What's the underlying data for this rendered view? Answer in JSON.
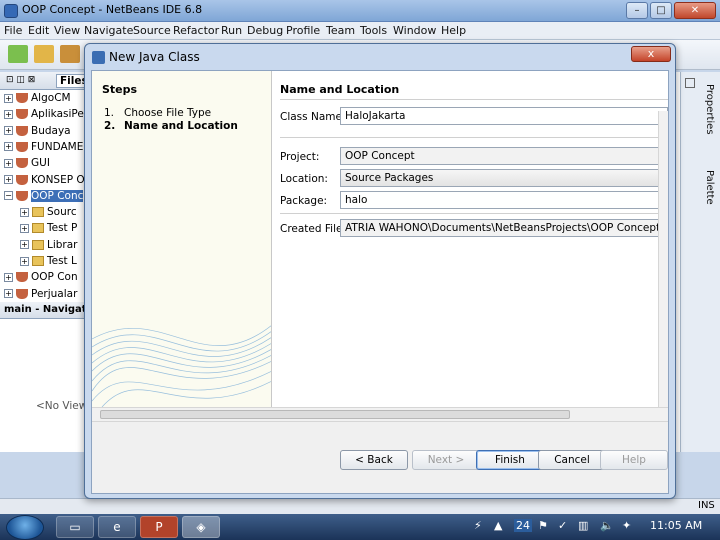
{
  "ide": {
    "title": "OOP Concept - NetBeans IDE 6.8",
    "menu": [
      "File",
      "Edit",
      "View",
      "Navigate",
      "Source",
      "Refactor",
      "Run",
      "Debug",
      "Profile",
      "Team",
      "Tools",
      "Window",
      "Help"
    ],
    "tabs": {
      "files": "Files"
    },
    "tree": [
      {
        "label": "AlgoCM",
        "type": "project",
        "expanded": false
      },
      {
        "label": "AplikasiPe",
        "type": "project",
        "expanded": false
      },
      {
        "label": "Budaya",
        "type": "project",
        "expanded": false
      },
      {
        "label": "FUNDAME",
        "type": "project",
        "expanded": false
      },
      {
        "label": "GUI",
        "type": "project",
        "expanded": false
      },
      {
        "label": "KONSEP O",
        "type": "project",
        "expanded": false
      },
      {
        "label": "OOP Conc",
        "type": "project",
        "expanded": true,
        "selected": true
      },
      {
        "label": "Sourc",
        "type": "folder",
        "indent": 1
      },
      {
        "label": "Test P",
        "type": "folder",
        "indent": 1
      },
      {
        "label": "Librar",
        "type": "folder",
        "indent": 1
      },
      {
        "label": "Test L",
        "type": "folder",
        "indent": 1
      },
      {
        "label": "OOP Con",
        "type": "project",
        "expanded": false
      },
      {
        "label": "Perjualar",
        "type": "project",
        "expanded": false
      }
    ],
    "navigator_title": "main - Navigato",
    "navigator_empty": "<No View A",
    "right_tabs": [
      "Properties",
      "Palette"
    ],
    "status": "INS"
  },
  "dialog": {
    "title": "New Java Class",
    "close_label": "x",
    "steps_title": "Steps",
    "steps": [
      {
        "num": "1.",
        "label": "Choose File Type",
        "active": false
      },
      {
        "num": "2.",
        "label": "Name and Location",
        "active": true
      }
    ],
    "section_title": "Name and Location",
    "fields": {
      "class_name_label": "Class Name:",
      "class_name_value": "HaloJakarta",
      "project_label": "Project:",
      "project_value": "OOP Concept",
      "location_label": "Location:",
      "location_value": "Source Packages",
      "package_label": "Package:",
      "package_value": "halo",
      "created_file_label": "Created File:",
      "created_file_value": "ATRIA WAHONO\\Documents\\NetBeansProjects\\OOP Concept\\src\\halo\\H"
    },
    "buttons": {
      "back": "< Back",
      "next": "Next >",
      "finish": "Finish",
      "cancel": "Cancel",
      "help": "Help"
    }
  },
  "taskbar": {
    "clock": "11:05 AM",
    "tray_number": "24",
    "apps": [
      "explorer",
      "ie",
      "powerpoint",
      "netbeans"
    ]
  }
}
